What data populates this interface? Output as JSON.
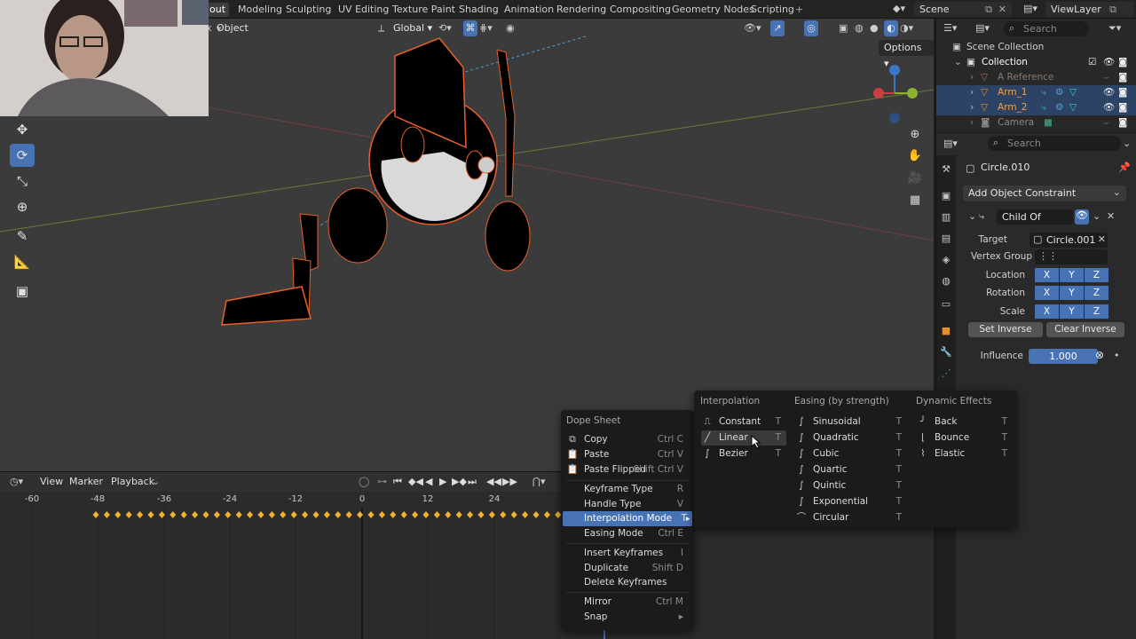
{
  "topbar": {
    "tabs": [
      {
        "label": "out",
        "active": true
      },
      {
        "label": "Modeling"
      },
      {
        "label": "Sculpting"
      },
      {
        "label": "UV Editing"
      },
      {
        "label": "Texture Paint"
      },
      {
        "label": "Shading"
      },
      {
        "label": "Animation"
      },
      {
        "label": "Rendering"
      },
      {
        "label": "Compositing"
      },
      {
        "label": "Geometry Nodes"
      },
      {
        "label": "Scripting"
      }
    ],
    "add_tab": "+",
    "scene": "Scene",
    "view_layer": "ViewLayer"
  },
  "viewport": {
    "mode": "Object",
    "transform_orientation": "Global",
    "options": "Options",
    "close_x": "x"
  },
  "outliner": {
    "search_placeholder": "Search",
    "scene_collection": "Scene Collection",
    "collection": "Collection",
    "items": [
      {
        "label": "A Reference"
      },
      {
        "label": "Arm_1"
      },
      {
        "label": "Arm_2"
      },
      {
        "label": "Camera"
      }
    ]
  },
  "properties": {
    "search_placeholder": "Search",
    "object_name": "Circle.010",
    "add_constraint": "Add Object Constraint",
    "constraint_name": "Child Of",
    "target_label": "Target",
    "target_value": "Circle.001",
    "vertex_group_label": "Vertex Group",
    "location_label": "Location",
    "rotation_label": "Rotation",
    "scale_label": "Scale",
    "x": "X",
    "y": "Y",
    "z": "Z",
    "set_inverse": "Set Inverse",
    "clear_inverse": "Clear Inverse",
    "influence_label": "Influence",
    "influence_value": "1.000",
    "influence_fraction": 1.0
  },
  "timeline": {
    "menus": [
      "View",
      "Marker",
      "Playback"
    ],
    "ticks": [
      "-60",
      "-48",
      "-36",
      "-24",
      "-12",
      "0",
      "12",
      "24"
    ]
  },
  "dope_menu": {
    "title": "Dope Sheet",
    "items": [
      {
        "label": "Copy",
        "shortcut": "Ctrl C",
        "icon": "copy-icon"
      },
      {
        "label": "Paste",
        "shortcut": "Ctrl V",
        "icon": "paste-icon"
      },
      {
        "label": "Paste Flipped",
        "shortcut": "Shift Ctrl V",
        "icon": "paste-flipped-icon"
      },
      {
        "label": "Keyframe Type",
        "shortcut": "R"
      },
      {
        "label": "Handle Type",
        "shortcut": "V"
      },
      {
        "label": "Interpolation Mode",
        "shortcut": "T",
        "highlight": true
      },
      {
        "label": "Easing Mode",
        "shortcut": "Ctrl E"
      },
      {
        "label": "Insert Keyframes",
        "shortcut": "I"
      },
      {
        "label": "Duplicate",
        "shortcut": "Shift D"
      },
      {
        "label": "Delete Keyframes",
        "shortcut": ""
      },
      {
        "label": "Mirror",
        "shortcut": "Ctrl M"
      },
      {
        "label": "Snap",
        "shortcut": ""
      }
    ]
  },
  "interp_menu": {
    "col1_title": "Interpolation",
    "col2_title": "Easing (by strength)",
    "col3_title": "Dynamic Effects",
    "col1": [
      {
        "label": "Constant",
        "shortcut": "T"
      },
      {
        "label": "Linear",
        "shortcut": "T"
      },
      {
        "label": "Bezier",
        "shortcut": "T"
      }
    ],
    "col2": [
      {
        "label": "Sinusoidal",
        "shortcut": "T"
      },
      {
        "label": "Quadratic",
        "shortcut": "T"
      },
      {
        "label": "Cubic",
        "shortcut": "T"
      },
      {
        "label": "Quartic",
        "shortcut": "T"
      },
      {
        "label": "Quintic",
        "shortcut": "T"
      },
      {
        "label": "Exponential",
        "shortcut": "T"
      },
      {
        "label": "Circular",
        "shortcut": "T"
      }
    ],
    "col3": [
      {
        "label": "Back",
        "shortcut": "T"
      },
      {
        "label": "Bounce",
        "shortcut": "T"
      },
      {
        "label": "Elastic",
        "shortcut": "T"
      }
    ]
  },
  "colors": {
    "accent": "#4772b3",
    "selection_outline": "#e8602a",
    "keyframe": "#f0b030"
  }
}
